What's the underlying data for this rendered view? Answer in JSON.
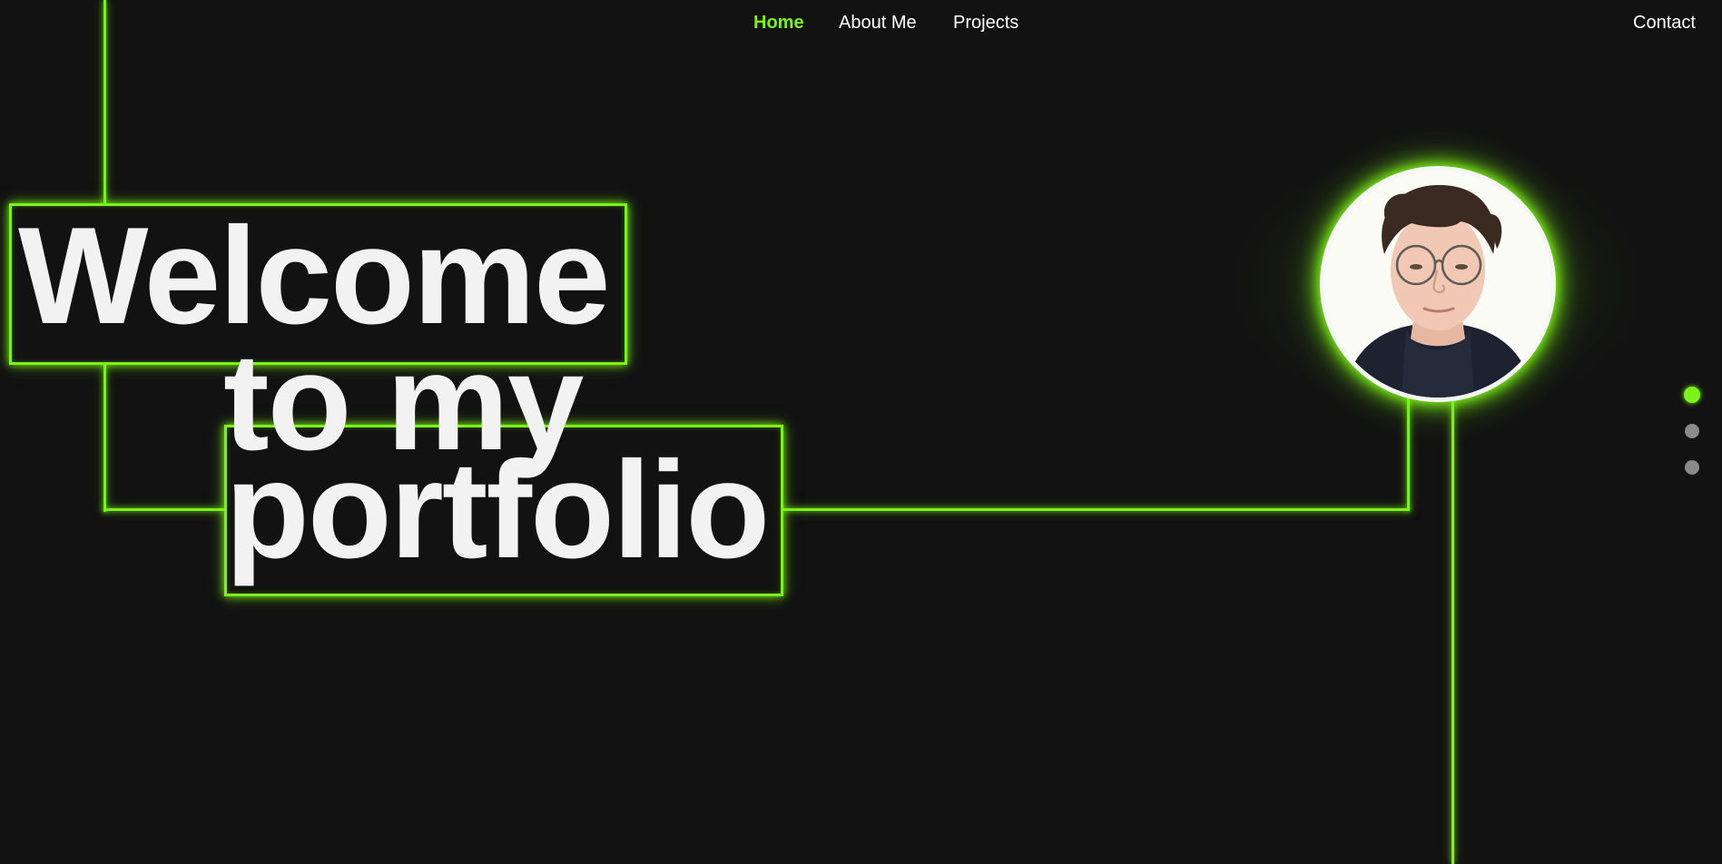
{
  "nav": {
    "items": [
      {
        "label": "Home",
        "active": true
      },
      {
        "label": "About Me",
        "active": false
      },
      {
        "label": "Projects",
        "active": false
      }
    ],
    "contact_label": "Contact"
  },
  "hero": {
    "line1": "Welcome",
    "line2": "to my",
    "line3": "portfolio"
  },
  "avatar": {
    "icon": "profile-photo"
  },
  "section_dots": {
    "count": 3,
    "active_index": 0
  },
  "colors": {
    "accent": "#7cf21a",
    "background": "#121212",
    "text": "#f2f2f2",
    "dot_inactive": "#8a8a8a"
  }
}
